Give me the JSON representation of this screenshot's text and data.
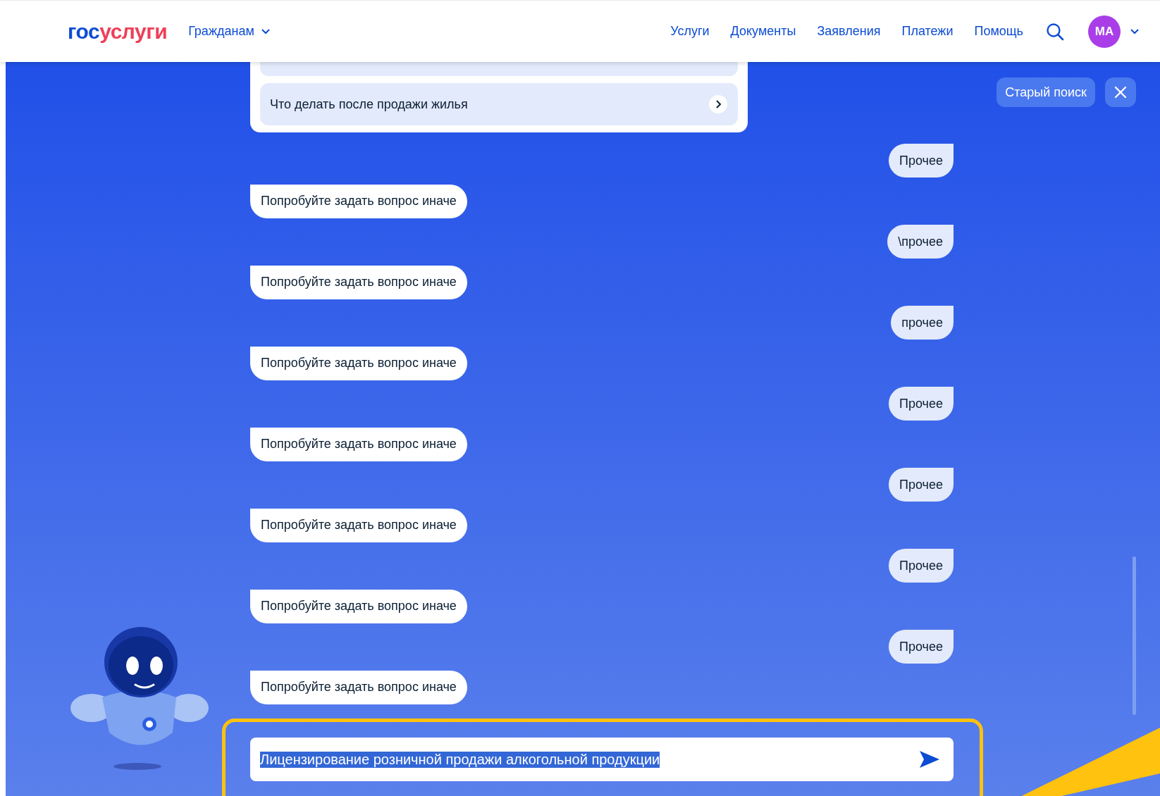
{
  "header": {
    "logo_parts": [
      "гос",
      "услуги"
    ],
    "audience": "Гражданам",
    "nav": [
      "Услуги",
      "Документы",
      "Заявления",
      "Платежи",
      "Помощь"
    ],
    "avatar": "МА"
  },
  "suggestions": [
    {
      "cut": true
    },
    {
      "label": "Что делать после продажи жилья",
      "cut": false
    }
  ],
  "top_actions": {
    "old_search": "Старый поиск"
  },
  "messages": [
    {
      "kind": "user",
      "text": "Прочее"
    },
    {
      "kind": "bot",
      "text": "Попробуйте задать вопрос иначе"
    },
    {
      "kind": "user",
      "text": "\\прочее"
    },
    {
      "kind": "bot",
      "text": "Попробуйте задать вопрос иначе"
    },
    {
      "kind": "user",
      "text": "прочее"
    },
    {
      "kind": "bot",
      "text": "Попробуйте задать вопрос иначе"
    },
    {
      "kind": "user",
      "text": "Прочее"
    },
    {
      "kind": "bot",
      "text": "Попробуйте задать вопрос иначе"
    },
    {
      "kind": "user",
      "text": "Прочее"
    },
    {
      "kind": "bot",
      "text": "Попробуйте задать вопрос иначе"
    },
    {
      "kind": "user",
      "text": "Прочее"
    },
    {
      "kind": "bot",
      "text": "Попробуйте задать вопрос иначе"
    },
    {
      "kind": "user",
      "text": "Прочее"
    },
    {
      "kind": "bot",
      "text": "Попробуйте задать вопрос иначе"
    }
  ],
  "input": {
    "value": "Лицензирование розничной продажи алкогольной продукции",
    "text_selected": true
  }
}
